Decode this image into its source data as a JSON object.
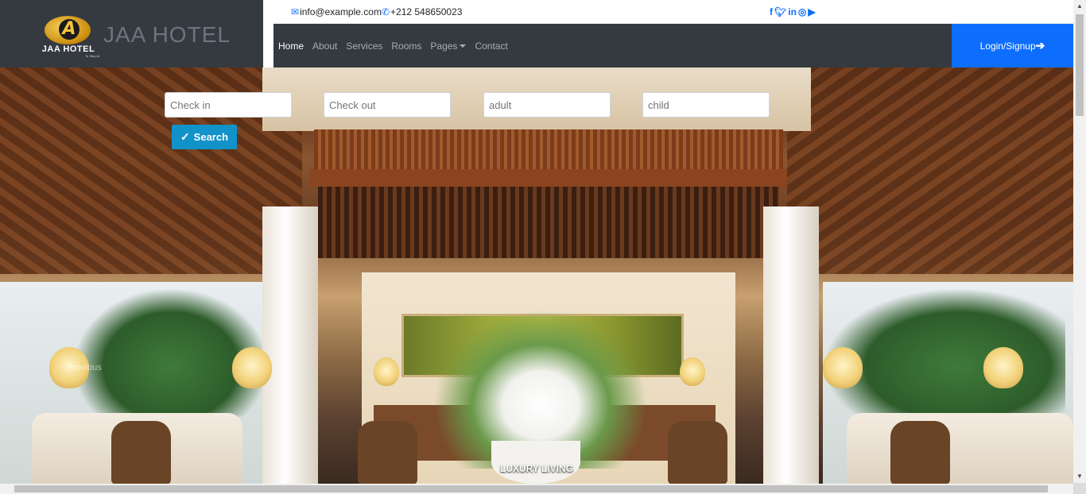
{
  "brand": {
    "logo_letter": "A",
    "logo_text": "JAA HOTEL",
    "logo_subtext": "To Stay At",
    "title": "JAA HOTEL"
  },
  "contact": {
    "email": "info@example.com",
    "phone": "+212 548650023"
  },
  "social_icons": [
    "facebook-icon",
    "twitter-icon",
    "linkedin-icon",
    "instagram-icon",
    "youtube-icon"
  ],
  "nav": {
    "items": [
      {
        "label": "Home",
        "active": true
      },
      {
        "label": "About"
      },
      {
        "label": "Services"
      },
      {
        "label": "Rooms"
      },
      {
        "label": "Pages",
        "dropdown": true
      },
      {
        "label": "Contact"
      }
    ],
    "login_label": "Login/Signup"
  },
  "booking": {
    "checkin_placeholder": "Check in",
    "checkout_placeholder": "Check out",
    "adult_placeholder": "adult",
    "child_placeholder": "child",
    "search_label": "Search"
  },
  "hero": {
    "prev_label": "Previous",
    "caption": "LUXURY LIVING"
  },
  "colors": {
    "dark": "#343a40",
    "primary": "#0d6efd",
    "search": "#1192c8"
  }
}
